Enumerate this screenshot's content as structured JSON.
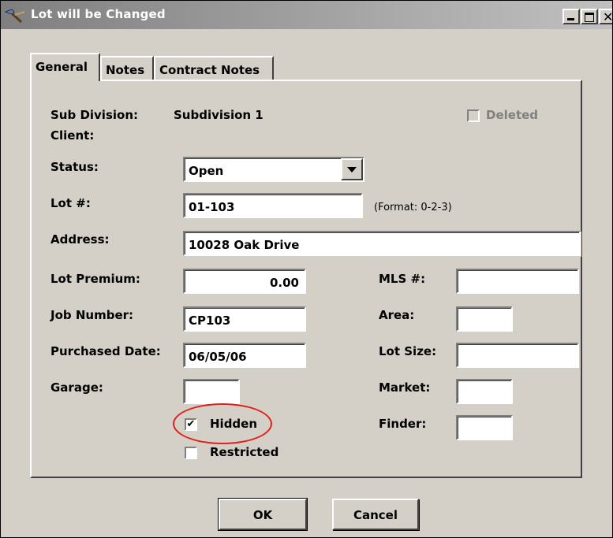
{
  "window": {
    "title": "Lot will be Changed",
    "icon": "hammer-app-icon",
    "controls": {
      "minimize": "minimize-icon",
      "maximize": "maximize-icon",
      "close_label": "✕"
    }
  },
  "tabs": [
    {
      "label": "General",
      "active": true
    },
    {
      "label": "Notes",
      "active": false
    },
    {
      "label": "Contract Notes",
      "active": false
    }
  ],
  "general": {
    "subdivision_label": "Sub Division:",
    "subdivision_value": "Subdivision 1",
    "client_label": "Client:",
    "deleted_label": "Deleted",
    "deleted_checked": false,
    "status_label": "Status:",
    "status_value": "Open",
    "lot_label": "Lot #:",
    "lot_value": "01-103",
    "lot_format_hint": "(Format: 0-2-3)",
    "address_label": "Address:",
    "address_value": "10028 Oak Drive",
    "lot_premium_label": "Lot Premium:",
    "lot_premium_value": "0.00",
    "job_number_label": "Job Number:",
    "job_number_value": "CP103",
    "purchased_date_label": "Purchased Date:",
    "purchased_date_value": "06/05/06",
    "garage_label": "Garage:",
    "garage_value": "",
    "hidden_label": "Hidden",
    "hidden_checked": true,
    "hidden_check_glyph": "✔",
    "restricted_label": "Restricted",
    "restricted_checked": false,
    "mls_label": "MLS #:",
    "mls_value": "",
    "area_label": "Area:",
    "area_value": "",
    "lot_size_label": "Lot Size:",
    "lot_size_value": "",
    "market_label": "Market:",
    "market_value": "",
    "finder_label": "Finder:",
    "finder_value": ""
  },
  "buttons": {
    "ok": "OK",
    "cancel": "Cancel"
  },
  "colors": {
    "annotation": "#e0201c",
    "title_bar": "#8c8c8c",
    "dialog_face": "#d4d0c8"
  }
}
